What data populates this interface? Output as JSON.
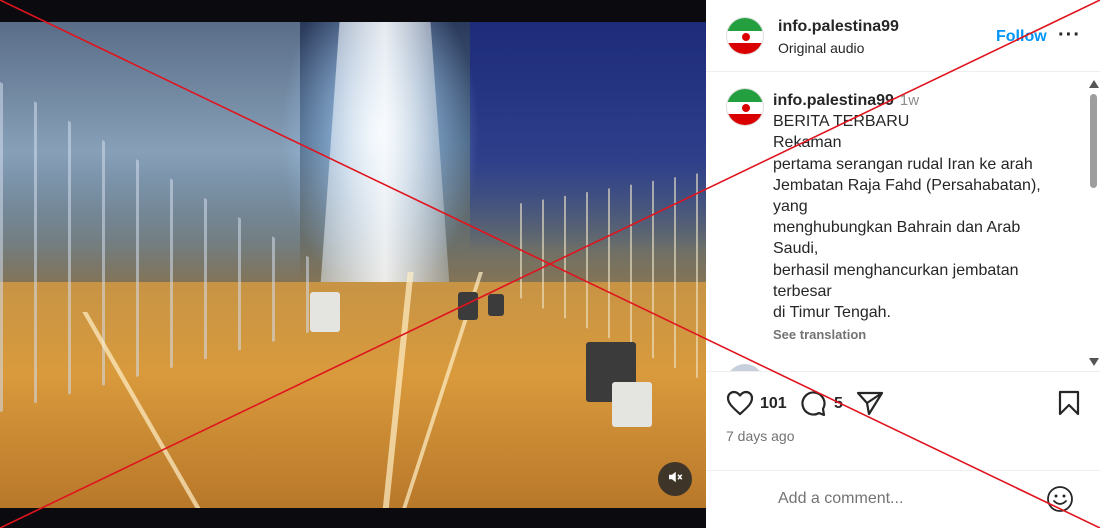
{
  "post": {
    "author": "info.palestina99",
    "audio": "Original audio",
    "follow_label": "Follow",
    "more_label": "···"
  },
  "caption": {
    "author": "info.palestina99",
    "time": "1w",
    "lines": [
      "BERITA TERBARU",
      "Rekaman",
      "pertama serangan rudal Iran ke arah",
      "Jembatan Raja Fahd (Persahabatan),",
      "yang",
      "menghubungkan Bahrain dan Arab",
      "Saudi,",
      "berhasil menghancurkan jembatan",
      "terbesar",
      "di Timur Tengah."
    ],
    "see_translation": "See translation"
  },
  "next_comment": {
    "author": "..."
  },
  "actions": {
    "likes": "101",
    "comments": "5",
    "date": "7 days ago"
  },
  "add_comment": {
    "placeholder": "Add a comment..."
  },
  "icons": {
    "like": "heart-icon",
    "comment": "comment-bubble-icon",
    "share": "paper-plane-icon",
    "save": "bookmark-icon",
    "mute": "speaker-muted-icon",
    "emoji": "emoji-smiley-icon"
  },
  "colors": {
    "follow": "#0095f6",
    "cross": "#e0141e",
    "muted_text": "#737373"
  }
}
